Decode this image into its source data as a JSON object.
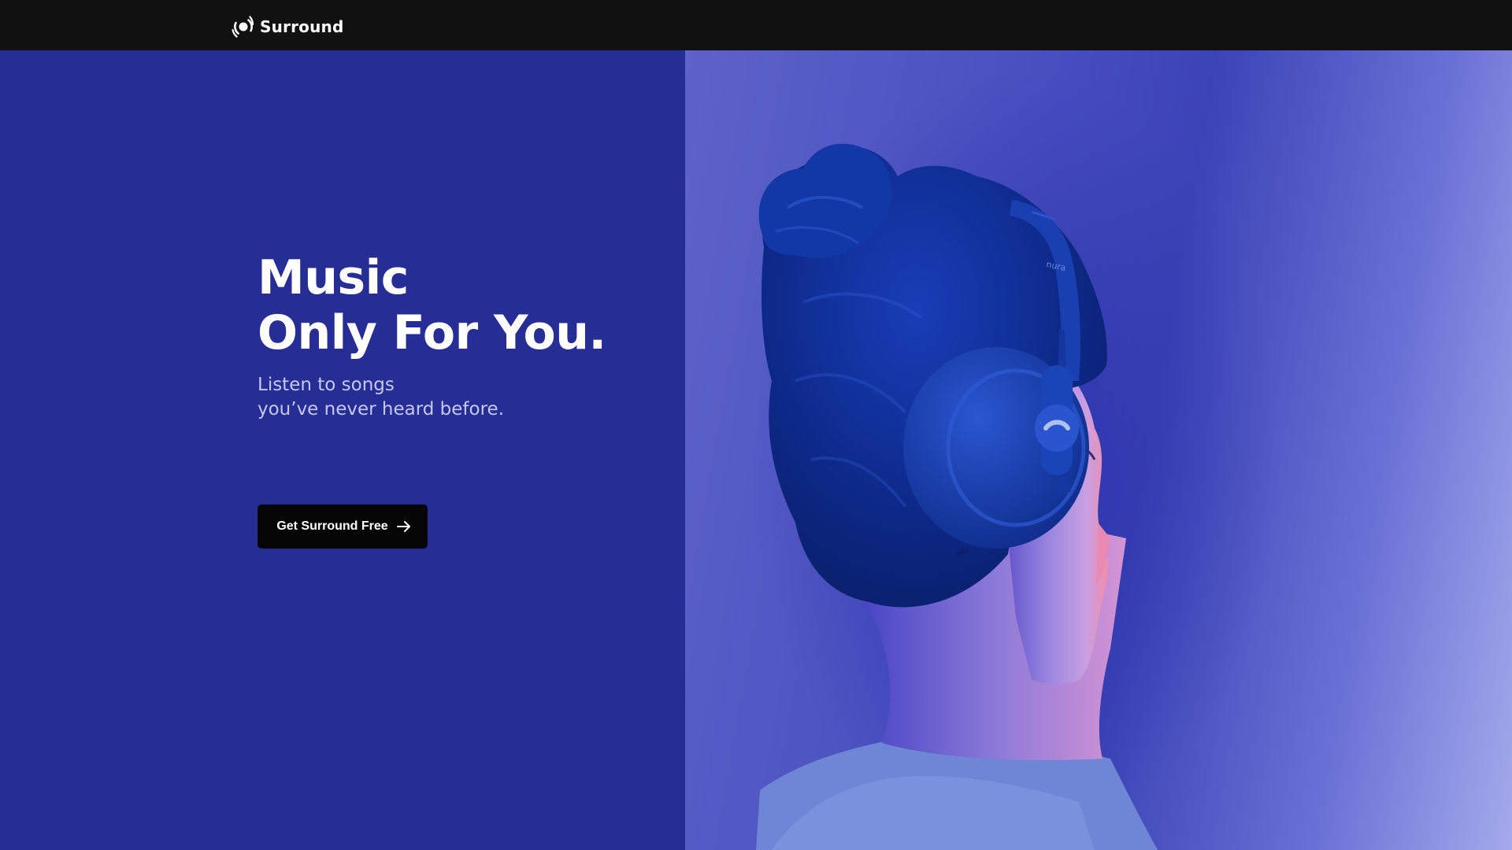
{
  "header": {
    "brand_name": "Surround",
    "brand_icon": "surround-logo-icon"
  },
  "hero": {
    "headline_line1": "Music",
    "headline_line2": "Only For You.",
    "subline_line1": "Listen to songs",
    "subline_line2": "you’ve never heard before.",
    "cta_label": "Get Surround Free",
    "cta_icon": "arrow-right-icon",
    "image_subject": "woman-with-headphones-photo",
    "headphone_brand_text": "nura"
  },
  "colors": {
    "topbar": "#111111",
    "hero_background": "#262e96",
    "cta_background": "#050505",
    "text_primary": "#ffffff",
    "text_secondary": "#c4c8ee",
    "photo_background": "#5d63c9"
  }
}
